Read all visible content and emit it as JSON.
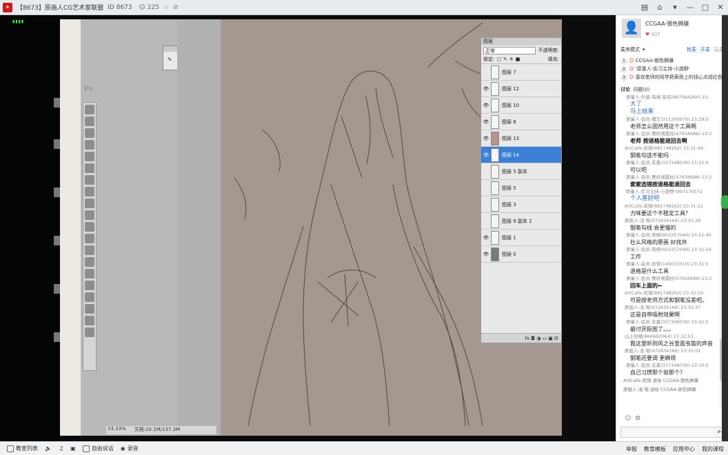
{
  "window": {
    "title": "【8673】原画人CG艺术家联盟",
    "room_id": "ID 8673",
    "viewers": "225"
  },
  "photoshop": {
    "ps_logo": "Ps",
    "brush_panel_label": "画笔",
    "zoom": "33.33%",
    "doc_size": "文档:20.1M/137.3M",
    "layers_panel": {
      "tab": "图层",
      "blend_mode": "正常",
      "opacity_label": "不透明度:",
      "lock_label": "锁定:",
      "fill_label": "填充:",
      "layers": [
        {
          "name": "图层 7",
          "visible": false,
          "thumb": "blank"
        },
        {
          "name": "图层 12",
          "visible": true,
          "thumb": "blank"
        },
        {
          "name": "图层 10",
          "visible": true,
          "thumb": "blank"
        },
        {
          "name": "图层 8",
          "visible": true,
          "thumb": "blank"
        },
        {
          "name": "图层 13",
          "visible": true,
          "thumb": "fig"
        },
        {
          "name": "图层 14",
          "visible": true,
          "thumb": "blank",
          "active": true
        },
        {
          "name": "图层 5 副本",
          "visible": false,
          "thumb": "blank"
        },
        {
          "name": "图层 5",
          "visible": false,
          "thumb": "blank"
        },
        {
          "name": "图层 3",
          "visible": false,
          "thumb": "blank"
        },
        {
          "name": "图层 9 副本 2",
          "visible": false,
          "thumb": "blank"
        },
        {
          "name": "图层 1",
          "visible": true,
          "thumb": "blank"
        },
        {
          "name": "图层 0",
          "visible": true,
          "thumb": "dark"
        }
      ],
      "footer_icons": "fx ◘ ◑ ▭ ▣ ⊟"
    }
  },
  "bottombar": {
    "item1": "教室列表",
    "item2": "自由说话",
    "item3": "录音",
    "right1": "举报",
    "right2": "教育模板",
    "right3": "应用中心",
    "right4": "我的课程"
  },
  "side": {
    "user_name": "CCGAA-银色狮骥",
    "likes": "307",
    "mode_label": "麦序模式",
    "tabs": [
      "抢麦",
      "开麦",
      "玩麦"
    ],
    "mic_list": [
      {
        "num": "1",
        "name": "CCGAA-银色狮骥"
      },
      {
        "num": "2",
        "name": "'原童人-实习主持-小游野'"
      },
      {
        "num": "3",
        "name": "喜欢老师的同学把表扬上的钱心点成红色"
      }
    ],
    "chat_tab1": "讨论",
    "chat_tab2": "问题",
    "chat_tab2_count": "(0)",
    "messages": [
      {
        "meta": "·原童人-外援-淘湘-留名(867568264) 23:",
        "text": "大了",
        "style": "blue"
      },
      {
        "meta": "",
        "text": "马上结束",
        "style": "blue"
      },
      {
        "meta": "·原童人-会员-魔王(311309979) 23:29:5",
        "text": "老师怎么固然用这个工具啊",
        "style": ""
      },
      {
        "meta": "·原童人-会员-曹好溯霞杖(47658686) 23:2",
        "text": "老师 按退格能退回去啊",
        "style": "big"
      },
      {
        "meta": "ArtCalls-凯锦(881748262) 23:31:48",
        "text": "钢笔勾选不能吗",
        "style": ""
      },
      {
        "meta": "·原童人-会员-玄夏(337348039) 23:31:0",
        "text": "可以吧",
        "style": ""
      },
      {
        "meta": "·原童人-会员-曹好溯霞杖(47658686) 23:2",
        "text": "套索选错按退格能退回去",
        "style": "big"
      },
      {
        "meta": "'原童人-实习主持-小游野'(997170572",
        "text": "个人喜好吧",
        "style": "blue"
      },
      {
        "meta": "ArtCalls-凯锦(881748262) 23:31:22",
        "text": "力味要这个不稳定工具？",
        "style": ""
      },
      {
        "meta": "原画人-浅 喵(972834166) 23:31:26",
        "text": "钢笔勾线 会更慢的",
        "style": ""
      },
      {
        "meta": "·原童人-会员-简榕(950257044) 23:31:46",
        "text": "社么风格的原画 好找共",
        "style": ""
      },
      {
        "meta": "·原童人-会员-简榕(950257044) 23:31:54",
        "text": "工作",
        "style": ""
      },
      {
        "meta": "·原童人-会员-尚赞(149033319) 23:31:5",
        "text": "退格是什么工具",
        "style": ""
      },
      {
        "meta": "·原童人-会员-曹好溯霞杖(47658686) 23:2",
        "text": "回车上面的←",
        "style": "big"
      },
      {
        "meta": "ArtCalls-凯锦(881748262) 23:32:16",
        "text": "可是按老师方式和钢笔没差吧。",
        "style": ""
      },
      {
        "meta": "原画人-浅 喵(972834166) 23:32:47",
        "text": "这是自带吸附效果啊",
        "style": ""
      },
      {
        "meta": "·原童人-会员-玄夏(337348039) 23:32:5",
        "text": "最讨厌抠图了。。。",
        "style": ""
      },
      {
        "meta": "山上份橘(866662064) 23:32:53",
        "text": "我这里听到风之谷里面虫笛的声音",
        "style": ""
      },
      {
        "meta": "原画人-浅 喵(972834166) 23:33:01",
        "text": "钢笔还要调 更麻烦",
        "style": ""
      },
      {
        "meta": "·原童人-会员-玄夏(337348039) 23:33:0",
        "text": "自己习惯那个就那个？",
        "style": ""
      }
    ],
    "gifts": [
      "ArtCalls-凯锦 送给 CCGAA-银色狮骥",
      "原画人-浅 喵 送给 CCGAA-银色狮骥"
    ]
  },
  "colors": {
    "accent_blue": "#3b7fd6",
    "brand_red": "#c81e1e",
    "canvas": "#a49891"
  }
}
